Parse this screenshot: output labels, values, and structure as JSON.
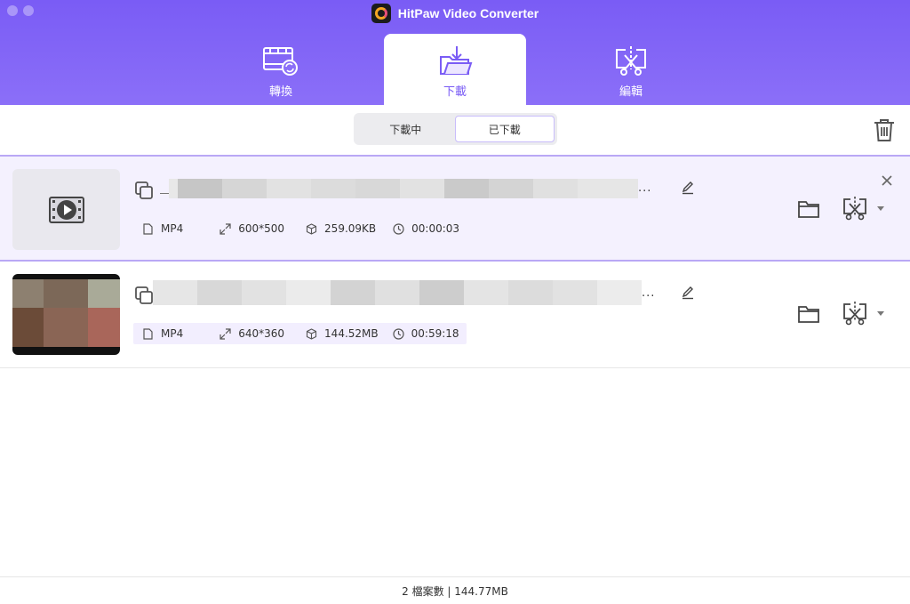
{
  "app": {
    "title": "HitPaw Video Converter"
  },
  "main_tabs": [
    {
      "label": "轉換",
      "icon": "film-convert-icon",
      "active": false
    },
    {
      "label": "下載",
      "icon": "download-folder-icon",
      "active": true
    },
    {
      "label": "編輯",
      "icon": "scissors-edit-icon",
      "active": false
    }
  ],
  "sub_tabs": [
    {
      "label": "下載中",
      "active": false
    },
    {
      "label": "已下載",
      "active": true
    }
  ],
  "toolbar": {
    "delete_icon": "trash-icon"
  },
  "items": [
    {
      "selected": true,
      "ellipsis": "...",
      "format": "MP4",
      "resolution": "600*500",
      "size": "259.09KB",
      "duration": "00:00:03"
    },
    {
      "selected": false,
      "ellipsis": "...",
      "format": "MP4",
      "resolution": "640*360",
      "size": "144.52MB",
      "duration": "00:59:18"
    }
  ],
  "footer": {
    "summary": "2 檔案數 | 144.77MB"
  },
  "colors": {
    "accent": "#7a5cf5",
    "header_bg": "#8b6ff8",
    "selected_row": "#f4f1fe"
  }
}
